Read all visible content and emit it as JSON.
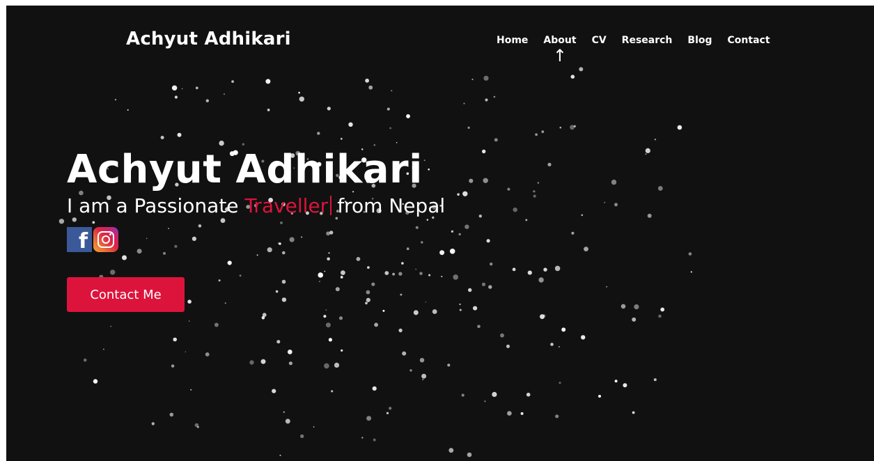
{
  "nav": {
    "brand": "Achyut Adhikari",
    "links": [
      "Home",
      "About",
      "CV",
      "Research",
      "Blog",
      "Contact"
    ],
    "active_indicator": "↑"
  },
  "hero": {
    "title": "Achyut Adhikari",
    "subtitle_prefix": "I am a Passionate",
    "subtitle_highlight": "Traveller",
    "subtitle_suffix": "from Nepal",
    "contact_button": "Contact Me"
  },
  "socials": {
    "facebook_icon": "facebook-icon",
    "instagram_icon": "instagram-icon",
    "facebook_glyph": "f"
  },
  "colors": {
    "background": "#111111",
    "accent": "#dc143c",
    "text": "#ffffff",
    "particles": "#ffffff"
  }
}
